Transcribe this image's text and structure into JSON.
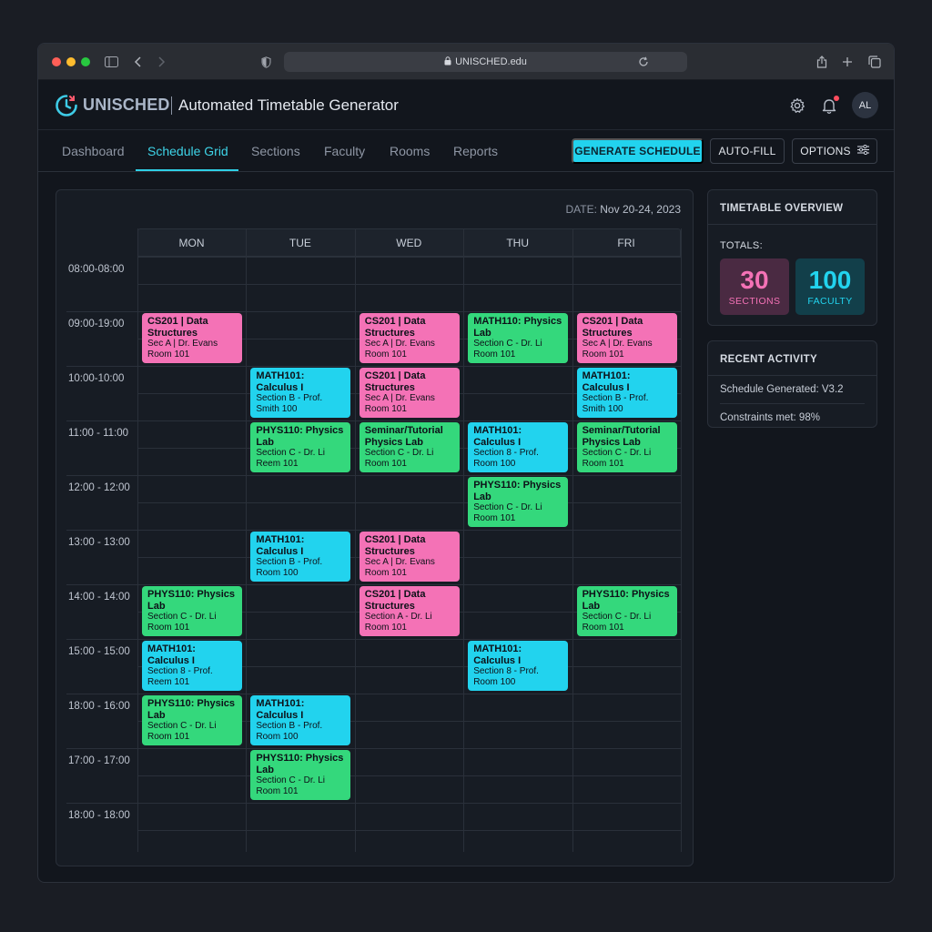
{
  "browser": {
    "url": "UNISCHED.edu"
  },
  "header": {
    "brand": "UNISCHED",
    "title": "Automated Timetable Generator",
    "avatar": "AL"
  },
  "nav": {
    "tabs": [
      "Dashboard",
      "Schedule Grid",
      "Sections",
      "Faculty",
      "Rooms",
      "Reports"
    ],
    "active_tab": "Schedule Grid",
    "generate_label": "GENERATE SCHEDULE",
    "autofill_label": "AUTO-FILL",
    "options_label": "OPTIONS"
  },
  "schedule": {
    "date_key": "DATE:",
    "date_value": "Nov 20-24, 2023",
    "days": [
      "MON",
      "TUE",
      "WED",
      "THU",
      "FRI"
    ],
    "times": [
      "08:00-08:00",
      "09:00-19:00",
      "10:00-10:00",
      "11:00 - 11:00",
      "12:00 - 12:00",
      "13:00 - 13:00",
      "14:00 - 14:00",
      "15:00 - 15:00",
      "18:00 - 16:00",
      "17:00 - 17:00",
      "18:00 - 18:00"
    ],
    "events": [
      {
        "day": 0,
        "slot": 1,
        "color": "pink",
        "title": "CS201 | Data Structures",
        "line1": "Sec A | Dr. Evans",
        "line2": "Room 101"
      },
      {
        "day": 2,
        "slot": 1,
        "color": "pink",
        "title": "CS201 | Data Structures",
        "line1": "Sec A | Dr. Evans",
        "line2": "Room 101"
      },
      {
        "day": 3,
        "slot": 1,
        "color": "green",
        "title": "MATH110: Physics Lab",
        "line1": "Section C - Dr. Li",
        "line2": "Room 101"
      },
      {
        "day": 4,
        "slot": 1,
        "color": "pink",
        "title": "CS201 | Data Structures",
        "line1": "Sec A | Dr. Evans",
        "line2": "Room 101"
      },
      {
        "day": 1,
        "slot": 2,
        "color": "cyan",
        "title": "MATH101: Calculus I",
        "line1": "Section B - Prof.",
        "line2": "Smith 100"
      },
      {
        "day": 2,
        "slot": 2,
        "color": "pink",
        "title": "CS201 | Data Structures",
        "line1": "Sec A | Dr. Evans",
        "line2": "Room 101"
      },
      {
        "day": 4,
        "slot": 2,
        "color": "cyan",
        "title": "MATH101: Calculus I",
        "line1": "Section B - Prof.",
        "line2": "Smith 100"
      },
      {
        "day": 1,
        "slot": 3,
        "color": "green",
        "title": "PHYS110: Physics Lab",
        "line1": "Section C - Dr. Li",
        "line2": "Reem 101"
      },
      {
        "day": 2,
        "slot": 3,
        "color": "green",
        "title": "Seminar/Tutorial Physics Lab",
        "line1": "Section C - Dr. Li",
        "line2": "Room 101"
      },
      {
        "day": 3,
        "slot": 3,
        "color": "cyan",
        "title": "MATH101: Calculus I",
        "line1": "Section 8 - Prof.",
        "line2": "Room 100"
      },
      {
        "day": 4,
        "slot": 3,
        "color": "green",
        "title": "Seminar/Tutorial Physics Lab",
        "line1": "Section C - Dr. Li",
        "line2": "Room 101"
      },
      {
        "day": 3,
        "slot": 4,
        "color": "green",
        "title": "PHYS110: Physics Lab",
        "line1": "Section C - Dr. Li",
        "line2": "Room 101"
      },
      {
        "day": 1,
        "slot": 5,
        "color": "cyan",
        "title": "MATH101: Calculus I",
        "line1": "Section B - Prof.",
        "line2": "Room 100"
      },
      {
        "day": 2,
        "slot": 5,
        "color": "pink",
        "title": "CS201 | Data Structures",
        "line1": "Sec A | Dr. Evans",
        "line2": "Room 101"
      },
      {
        "day": 0,
        "slot": 6,
        "color": "green",
        "title": "PHYS110: Physics Lab",
        "line1": "Section C - Dr. Li",
        "line2": "Room 101"
      },
      {
        "day": 2,
        "slot": 6,
        "color": "pink",
        "title": "CS201 | Data Structures",
        "line1": "Section A - Dr. Li",
        "line2": "Room 101"
      },
      {
        "day": 4,
        "slot": 6,
        "color": "green",
        "title": "PHYS110: Physics Lab",
        "line1": "Section C - Dr. Li",
        "line2": "Room 101"
      },
      {
        "day": 0,
        "slot": 7,
        "color": "cyan",
        "title": "MATH101: Calculus I",
        "line1": "Section 8 - Prof.",
        "line2": "Reem 101"
      },
      {
        "day": 3,
        "slot": 7,
        "color": "cyan",
        "title": "MATH101: Calculus I",
        "line1": "Section 8 - Prof.",
        "line2": "Room 100"
      },
      {
        "day": 0,
        "slot": 8,
        "color": "green",
        "title": "PHYS110: Physics Lab",
        "line1": "Section C - Dr. Li",
        "line2": "Room 101"
      },
      {
        "day": 1,
        "slot": 8,
        "color": "cyan",
        "title": "MATH101: Calculus I",
        "line1": "Section B - Prof.",
        "line2": "Room 100"
      },
      {
        "day": 1,
        "slot": 9,
        "color": "green",
        "title": "PHYS110: Physics Lab",
        "line1": "Section C - Dr. Li",
        "line2": "Room 101"
      }
    ]
  },
  "overview": {
    "title": "TIMETABLE OVERVIEW",
    "totals_label": "TOTALS:",
    "sections_count": "30",
    "sections_label": "SECTIONS",
    "faculty_count": "100",
    "faculty_label": "FACULTY"
  },
  "activity": {
    "title": "RECENT ACTIVITY",
    "items": [
      "Schedule Generated: V3.2",
      "Constraints met: 98%"
    ]
  },
  "colors": {
    "accent": "#22d3ee",
    "pink": "#f472b6",
    "green": "#34d87c"
  }
}
